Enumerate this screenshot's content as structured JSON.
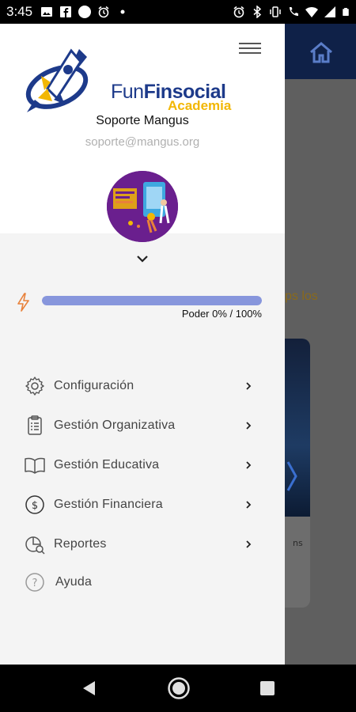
{
  "status_bar": {
    "time": "3:45",
    "icons_left": [
      "image-icon",
      "facebook-icon",
      "circle-icon",
      "alarm-icon",
      "dot-icon"
    ],
    "icons_right": [
      "alarm-icon",
      "bluetooth-icon",
      "vibrate-icon",
      "volte-icon",
      "wifi-icon",
      "signal-icon",
      "battery-icon"
    ]
  },
  "background_app": {
    "partial_text": "ps los",
    "card_text": "ns"
  },
  "drawer": {
    "logo": {
      "fun": "Fun",
      "finsocial": "Finsocial",
      "academia": "Academia"
    },
    "user": {
      "name": "Soporte Mangus",
      "email": "soporte@mangus.org"
    },
    "power": {
      "label": "Poder 0% / 100%",
      "progress": 0.0
    },
    "menu": [
      {
        "label": "Configuración",
        "icon": "gear-icon",
        "has_chevron": true
      },
      {
        "label": "Gestión Organizativa",
        "icon": "clipboard-icon",
        "has_chevron": true
      },
      {
        "label": "Gestión Educativa",
        "icon": "book-icon",
        "has_chevron": true
      },
      {
        "label": "Gestión Financiera",
        "icon": "dollar-icon",
        "has_chevron": true
      },
      {
        "label": "Reportes",
        "icon": "report-icon",
        "has_chevron": true
      },
      {
        "label": "Ayuda",
        "icon": "help-icon",
        "has_chevron": false
      }
    ]
  },
  "colors": {
    "brand_blue": "#1d3a8a",
    "brand_yellow": "#f2b705",
    "progress": "#8796dc",
    "power_icon": "#e8813a"
  }
}
